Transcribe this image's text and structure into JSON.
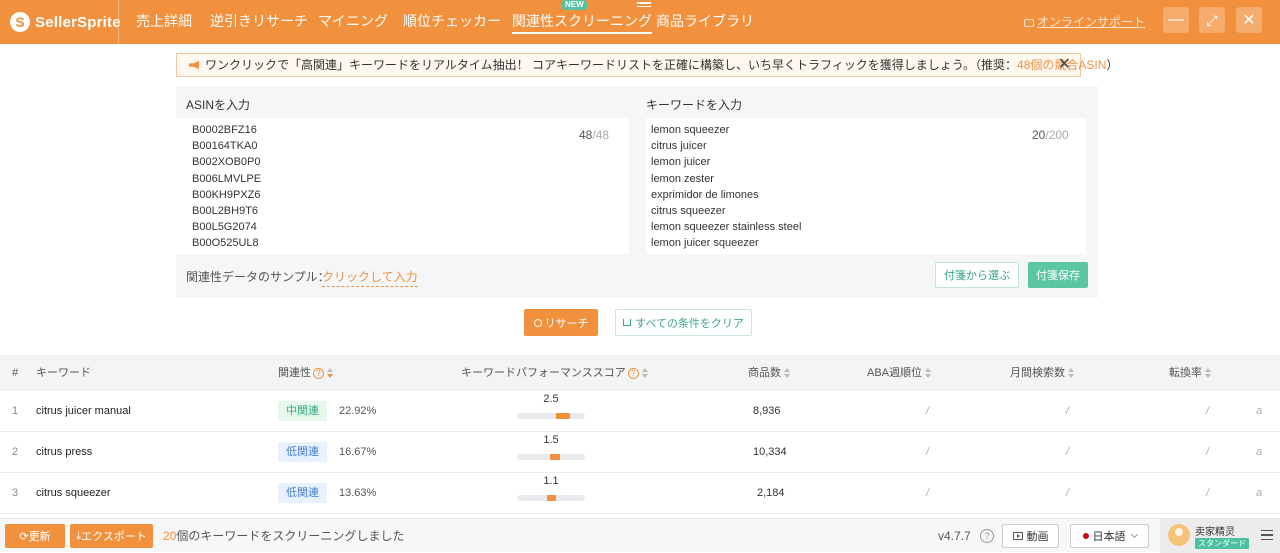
{
  "app": {
    "logo_text": "SellerSprite",
    "logo_mark": "S"
  },
  "nav": {
    "items": [
      {
        "label": "売上詳細"
      },
      {
        "label": "逆引きリサーチ"
      },
      {
        "label": "マイニング"
      },
      {
        "label": "順位チェッカー"
      },
      {
        "label": "関連性スクリーニング",
        "badge": "NEW",
        "active": true
      },
      {
        "label": "商品ライブラリ"
      }
    ],
    "support_label": "オンラインサポート"
  },
  "window": {
    "minimize": "—",
    "maximize": "⤢",
    "close": "✕"
  },
  "notice": {
    "text": "ワンクリックで「高関連」キーワードをリアルタイム抽出！ コアキーワードリストを正確に構築し、いち早くトラフィックを獲得しましょう。（推奨：",
    "highlight": "48個の競合ASIN",
    "suffix": "）",
    "close": "✕"
  },
  "asin_input": {
    "label": "ASINを入力",
    "lines": [
      "B0002BFZ16",
      "B00164TKA0",
      "B002XOB0P0",
      "B006LMVLPE",
      "B00KH9PXZ6",
      "B00L2BH9T6",
      "B00L5G2074",
      "B00O525UL8"
    ],
    "count": "48",
    "max": "/48"
  },
  "keyword_input": {
    "label": "キーワードを入力",
    "lines": [
      "lemon squeezer",
      "citrus juicer",
      "lemon juicer",
      "lemon zester",
      "exprimidor de limones",
      "citrus squeezer",
      "lemon squeezer stainless steel",
      "lemon juicer squeezer"
    ],
    "count": "20",
    "max": "/200"
  },
  "sample": {
    "label": "関連性データのサンプル：",
    "link": "クリックして入力"
  },
  "buttons": {
    "pick_tag": "付箋から選ぶ",
    "save_tag": "付箋保存",
    "search": "リサーチ",
    "clear": "すべての条件をクリア"
  },
  "table": {
    "headers": {
      "num": "#",
      "keyword": "キーワード",
      "relevance": "関連性",
      "score": "キーワードパフォーマンススコア",
      "products": "商品数",
      "aba": "ABA週順位",
      "monthly": "月間検索数",
      "conversion": "転換率"
    },
    "rows": [
      {
        "num": "1",
        "keyword": "citrus juicer manual",
        "badge": "中関連",
        "badge_type": "mid",
        "pct": "22.92%",
        "score": "2.5",
        "score_value": 2.5,
        "products": "8,936",
        "aba": "/",
        "monthly": "/",
        "conversion": "/",
        "extra": "a"
      },
      {
        "num": "2",
        "keyword": "citrus press",
        "badge": "低関連",
        "badge_type": "low",
        "pct": "16.67%",
        "score": "1.5",
        "score_value": 1.5,
        "products": "10,334",
        "aba": "/",
        "monthly": "/",
        "conversion": "/",
        "extra": "a"
      },
      {
        "num": "3",
        "keyword": "citrus squeezer",
        "badge": "低関連",
        "badge_type": "low",
        "pct": "13.63%",
        "score": "1.1",
        "score_value": 1.1,
        "products": "2,184",
        "aba": "/",
        "monthly": "/",
        "conversion": "/",
        "extra": "a"
      }
    ]
  },
  "footer": {
    "refresh": "更新",
    "export": "エクスポート",
    "status_count": "20",
    "status_text": "個のキーワードをスクリーニングしました",
    "version": "v4.7.7",
    "help": "?",
    "video": "動画",
    "language": "日本語",
    "user_name": "卖家精灵",
    "user_plan": "スタンダード"
  },
  "colors": {
    "accent": "#f2913d",
    "green": "#5ac7a1",
    "blue": "#4a7fd1"
  }
}
